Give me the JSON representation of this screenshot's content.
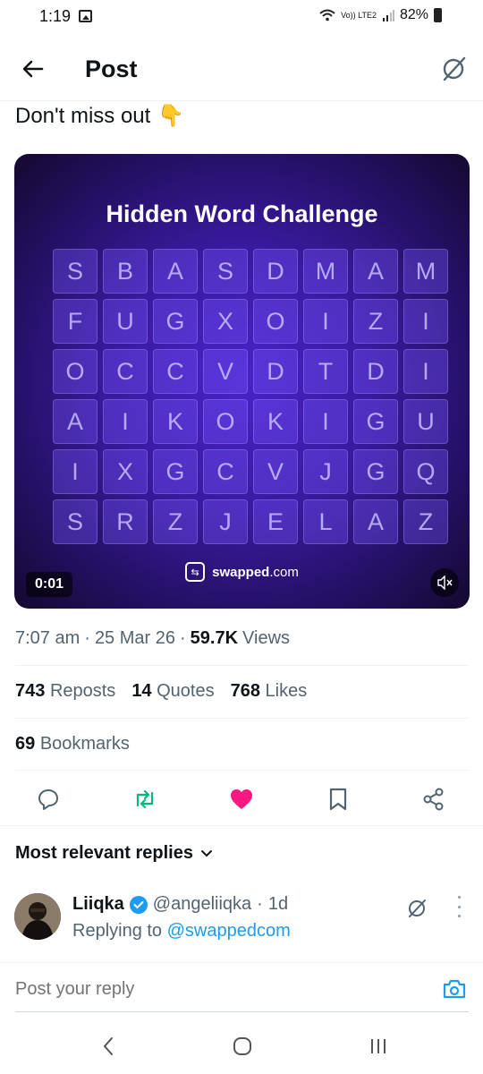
{
  "status_bar": {
    "time": "1:19",
    "network": "Vo)) LTE2",
    "battery": "82%"
  },
  "header": {
    "title": "Post",
    "back_icon": "arrow-left-icon",
    "grok_icon": "grok-icon"
  },
  "post": {
    "text": "Don't miss out",
    "emoji": "👇",
    "media": {
      "title": "Hidden Word Challenge",
      "grid": [
        [
          "S",
          "B",
          "A",
          "S",
          "D",
          "M",
          "A",
          "M"
        ],
        [
          "F",
          "U",
          "G",
          "X",
          "O",
          "I",
          "Z",
          "I"
        ],
        [
          "O",
          "C",
          "C",
          "V",
          "D",
          "T",
          "D",
          "I"
        ],
        [
          "A",
          "I",
          "K",
          "O",
          "K",
          "I",
          "G",
          "U"
        ],
        [
          "I",
          "X",
          "G",
          "C",
          "V",
          "J",
          "G",
          "Q"
        ],
        [
          "S",
          "R",
          "Z",
          "J",
          "E",
          "L",
          "A",
          "Z"
        ]
      ],
      "brand_name": "swapped",
      "brand_suffix": ".com",
      "timer": "0:01",
      "mute_icon": "muted-speaker-icon"
    },
    "meta": {
      "time": "7:07 am",
      "date": "25 Mar 26",
      "views_count": "59.7K",
      "views_label": "Views",
      "sep": "·"
    },
    "stats": {
      "reposts_count": "743",
      "reposts_label": "Reposts",
      "quotes_count": "14",
      "quotes_label": "Quotes",
      "likes_count": "768",
      "likes_label": "Likes",
      "bookmarks_count": "69",
      "bookmarks_label": "Bookmarks"
    },
    "actions": {
      "reply_icon": "reply-icon",
      "repost_icon": "repost-icon",
      "like_icon": "heart-filled-icon",
      "bookmark_icon": "bookmark-icon",
      "share_icon": "share-icon"
    },
    "colors": {
      "accent": "#1d9bf0",
      "repost": "#00ba7c",
      "like": "#f91880"
    }
  },
  "replies": {
    "header": "Most relevant replies",
    "items": [
      {
        "name": "Liiqka",
        "handle": "@angeliiqka",
        "sep": "·",
        "time": "1d",
        "replying_prefix": "Replying to",
        "replying_to": "@swappedcom"
      }
    ]
  },
  "compose": {
    "placeholder": "Post your reply",
    "camera_icon": "camera-icon"
  },
  "navbar": {
    "back_icon": "nav-back-icon",
    "home_icon": "nav-home-icon",
    "recents_icon": "nav-recents-icon"
  }
}
